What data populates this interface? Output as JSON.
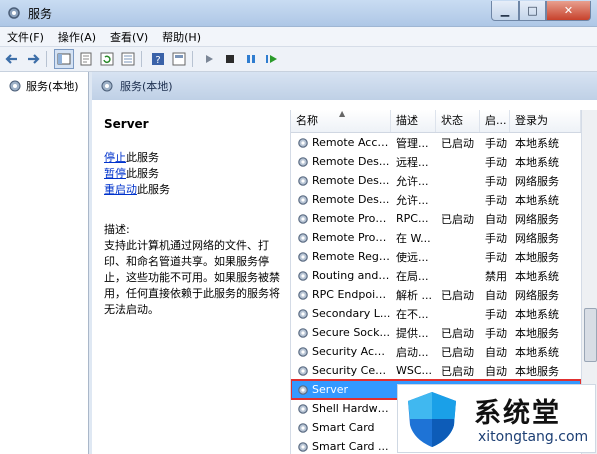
{
  "window": {
    "title": "服务",
    "min_symbol": "▁",
    "max_symbol": "□",
    "close_symbol": "✕"
  },
  "menu": [
    "文件(F)",
    "操作(A)",
    "查看(V)",
    "帮助(H)"
  ],
  "tree": {
    "root_label": "服务(本地)"
  },
  "pane": {
    "header_label": "服务(本地)",
    "selected_service": "Server",
    "actions": [
      {
        "link": "停止",
        "suffix": "此服务"
      },
      {
        "link": "暂停",
        "suffix": "此服务"
      },
      {
        "link": "重启动",
        "suffix": "此服务"
      }
    ],
    "description_label": "描述:",
    "description_text": "支持此计算机通过网络的文件、打印、和命名管道共享。如果服务停止，这些功能不可用。如果服务被禁用，任何直接依赖于此服务的服务将无法启动。"
  },
  "columns": [
    "名称",
    "描述",
    "状态",
    "启...",
    "登录为"
  ],
  "services": [
    {
      "name": "Remote Acce...",
      "desc": "管理...",
      "state": "已启动",
      "start": "手动",
      "logon": "本地系统"
    },
    {
      "name": "Remote Des...",
      "desc": "远程...",
      "state": "",
      "start": "手动",
      "logon": "本地系统"
    },
    {
      "name": "Remote Des...",
      "desc": "允许...",
      "state": "",
      "start": "手动",
      "logon": "网络服务"
    },
    {
      "name": "Remote Des...",
      "desc": "允许...",
      "state": "",
      "start": "手动",
      "logon": "本地系统"
    },
    {
      "name": "Remote Proc...",
      "desc": "RPC...",
      "state": "已启动",
      "start": "自动",
      "logon": "网络服务"
    },
    {
      "name": "Remote Proc...",
      "desc": "在 W...",
      "state": "",
      "start": "手动",
      "logon": "网络服务"
    },
    {
      "name": "Remote Regi...",
      "desc": "使远...",
      "state": "",
      "start": "手动",
      "logon": "本地服务"
    },
    {
      "name": "Routing and ...",
      "desc": "在局...",
      "state": "",
      "start": "禁用",
      "logon": "本地系统"
    },
    {
      "name": "RPC Endpoin...",
      "desc": "解析 ...",
      "state": "已启动",
      "start": "自动",
      "logon": "网络服务"
    },
    {
      "name": "Secondary L...",
      "desc": "在不...",
      "state": "",
      "start": "手动",
      "logon": "本地系统"
    },
    {
      "name": "Secure Sock...",
      "desc": "提供...",
      "state": "已启动",
      "start": "手动",
      "logon": "本地服务"
    },
    {
      "name": "Security Acco...",
      "desc": "启动...",
      "state": "已启动",
      "start": "自动",
      "logon": "本地系统"
    },
    {
      "name": "Security Cent...",
      "desc": "WSC...",
      "state": "已启动",
      "start": "自动",
      "logon": "本地服务"
    },
    {
      "name": "Server",
      "desc": "",
      "state": "",
      "start": "",
      "logon": "",
      "selected": true
    },
    {
      "name": "Shell Hardwa...",
      "desc": "",
      "state": "",
      "start": "",
      "logon": ""
    },
    {
      "name": "Smart Card",
      "desc": "",
      "state": "",
      "start": "",
      "logon": ""
    },
    {
      "name": "Smart Card ...",
      "desc": "",
      "state": "",
      "start": "",
      "logon": ""
    }
  ],
  "watermark": {
    "cn": "系统堂",
    "url": "xitongtang.com"
  },
  "colors": {
    "selection": "#3399ff",
    "highlight_border": "#e03030",
    "link": "#0033cc"
  }
}
